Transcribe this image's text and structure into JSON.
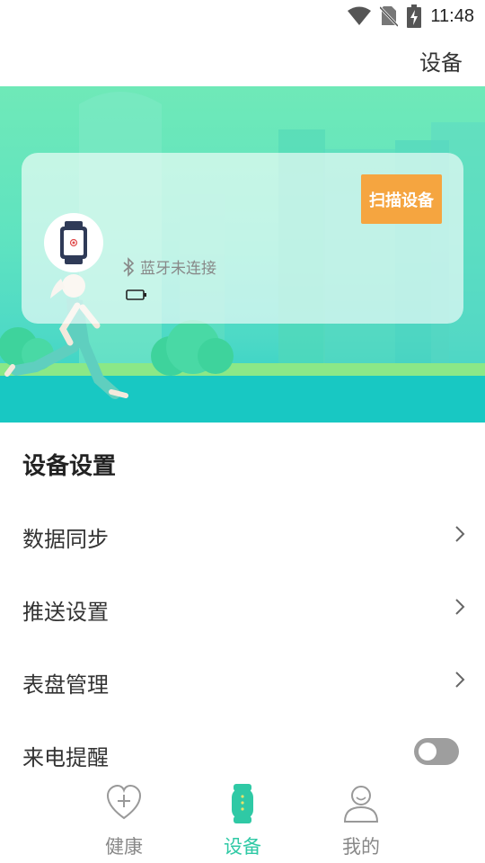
{
  "status_bar": {
    "time": "11:48",
    "icons": [
      "wifi-icon",
      "no-sim-icon",
      "battery-charging-icon"
    ]
  },
  "header": {
    "title": "设备"
  },
  "device_card": {
    "scan_button_label": "扫描设备",
    "bluetooth_status": "蓝牙未连接",
    "icons": [
      "watch-icon",
      "bluetooth-icon",
      "battery-icon"
    ]
  },
  "settings": {
    "section_title": "设备设置",
    "items": [
      {
        "label": "数据同步",
        "control": "chevron"
      },
      {
        "label": "推送设置",
        "control": "chevron"
      },
      {
        "label": "表盘管理",
        "control": "chevron"
      },
      {
        "label": "来电提醒",
        "control": "toggle",
        "enabled": false
      }
    ]
  },
  "bottom_nav": {
    "items": [
      {
        "label": "健康",
        "icon": "heart-plus-icon",
        "active": false
      },
      {
        "label": "设备",
        "icon": "band-icon",
        "active": true
      },
      {
        "label": "我的",
        "icon": "person-icon",
        "active": false
      }
    ]
  },
  "colors": {
    "accent": "#2fc9a5",
    "scan_button": "#f5a540",
    "hero_top": "#6fe9b8",
    "hero_bottom": "#29cdc6",
    "toggle_off": "#9e9e9e"
  }
}
